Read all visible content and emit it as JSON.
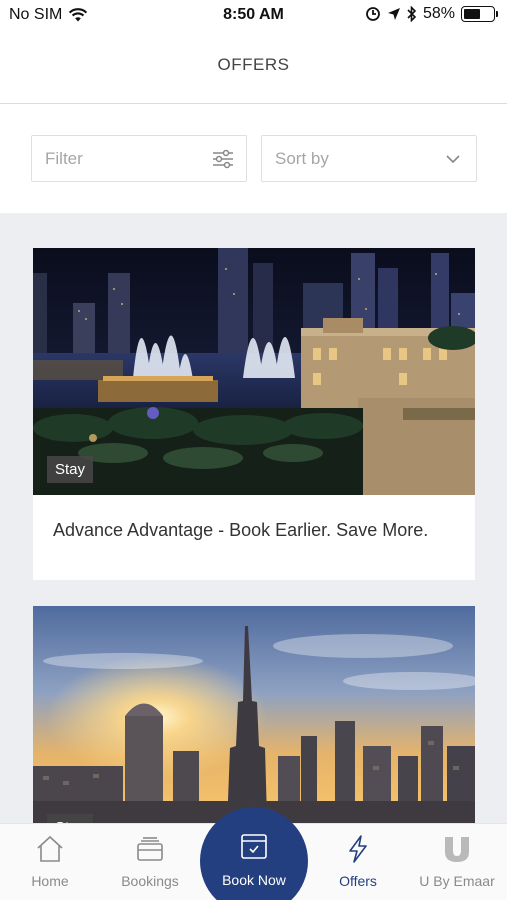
{
  "status_bar": {
    "carrier": "No SIM",
    "time": "8:50 AM",
    "battery_percent": "58%",
    "battery_level": 0.58,
    "icons": [
      "wifi-icon",
      "location-lock-icon",
      "location-arrow-icon",
      "bluetooth-icon",
      "battery-icon"
    ]
  },
  "header": {
    "title": "OFFERS"
  },
  "controls": {
    "filter_placeholder": "Filter",
    "sort_placeholder": "Sort by",
    "filter_icon": "sliders-icon",
    "sort_icon": "chevron-down-icon"
  },
  "offers": [
    {
      "category": "Stay",
      "title": "Advance Advantage - Book Earlier. Save More.",
      "image": "dubai-fountain-night-photo"
    },
    {
      "category": "Stay",
      "title": "",
      "image": "dubai-skyline-sunset-photo"
    }
  ],
  "tabbar": {
    "home": "Home",
    "bookings": "Bookings",
    "book_now": "Book Now",
    "offers": "Offers",
    "uby": "U By Emaar",
    "active": "offers",
    "active_color": "#243f80"
  }
}
